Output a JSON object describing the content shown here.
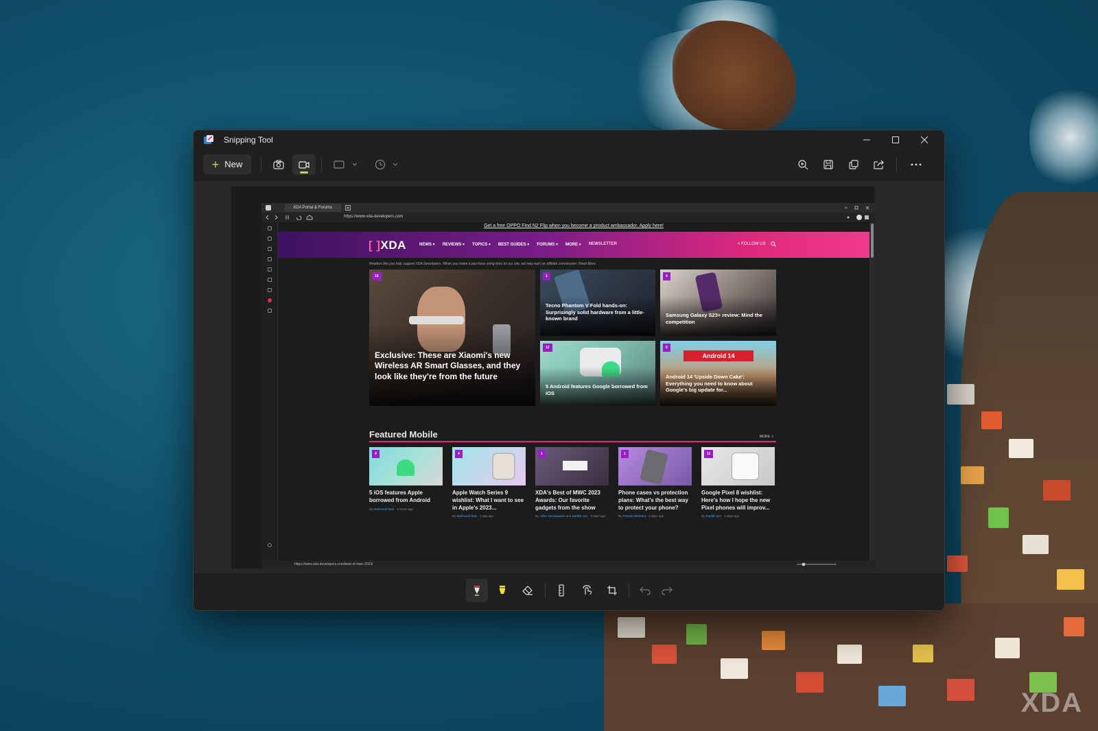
{
  "window": {
    "title": "Snipping Tool",
    "new_label": "New",
    "controls": {
      "minimize": "minimize-icon",
      "maximize": "maximize-icon",
      "close": "close-icon"
    }
  },
  "toolbar": {
    "icons": [
      "camera-icon",
      "video-icon",
      "rectangle-mode-icon",
      "timer-icon",
      "zoom-in-icon",
      "save-icon",
      "copy-icon",
      "share-icon",
      "more-icon"
    ],
    "accent": "#b8e04a"
  },
  "bottom_tools": [
    "ballpoint-pen-icon",
    "highlighter-icon",
    "eraser-icon",
    "ruler-icon",
    "touch-writing-icon",
    "crop-icon",
    "undo-icon",
    "redo-icon"
  ],
  "browser": {
    "tab_title": "XDA Portal & Forums",
    "url": "https://www.xda-developers.com",
    "status_url": "https://www.xda-developers.com/best-of-mwc-2023/"
  },
  "site": {
    "promo": "Get a free OPPO Find N2 Flip when you become a product ambassador. Apply here!",
    "logo": "XDA",
    "nav": [
      "NEWS ▾",
      "REVIEWS ▾",
      "TOPICS ▾",
      "BEST GUIDES ▾",
      "FORUMS ▾",
      "MORE ▾",
      "NEWSLETTER"
    ],
    "follow": "FOLLOW US",
    "disclaimer": "Readers like you help support XDA Developers. When you make a purchase using links on our site, we may earn an affiliate commission. Read More.",
    "hero": [
      {
        "badge": "10",
        "title": "Exclusive: These are Xiaomi's new Wireless AR Smart Glasses, and they look like they're from the future"
      },
      {
        "badge": "1",
        "title": "Tecno Phantom V Fold hands-on: Surprisingly solid hardware from a little-known brand"
      },
      {
        "badge": "4",
        "title": "Samsung Galaxy S23+ review: Mind the competition"
      },
      {
        "badge": "12",
        "title": "5 Android features Google borrowed from iOS"
      },
      {
        "badge": "5",
        "title": "Android 14 'Upside Down Cake': Everything you need to know about Google's big update for...",
        "banner": "Android 14"
      }
    ],
    "featured_title": "Featured Mobile",
    "featured_more": "MORE ↗",
    "featured": [
      {
        "badge": "4",
        "title": "5 iOS features Apple borrowed from Android",
        "author": "Mahmoud Itani",
        "time": "3 hours ago"
      },
      {
        "badge": "4",
        "title": "Apple Watch Series 9 wishlist: What I want to see in Apple's 2023...",
        "author": "Mahmoud Itani",
        "time": "1 day ago"
      },
      {
        "badge": "1",
        "title": "XDA's Best of MWC 2023 Awards: Our favorite gadgets from the show",
        "author": "João Carrasqueira",
        "author2": "Karthik Iyer",
        "time": "3 days ago"
      },
      {
        "badge": "1",
        "title": "Phone cases vs protection plans: What's the best way to protect your phone?",
        "author": "Pranob Mehrotra",
        "time": "2 days ago"
      },
      {
        "badge": "11",
        "title": "Google Pixel 8 wishlist: Here's how I hope the new Pixel phones will improv...",
        "author": "Karthik Iyer",
        "time": "4 days ago"
      }
    ]
  },
  "wallpaper_watermark": "XDA"
}
